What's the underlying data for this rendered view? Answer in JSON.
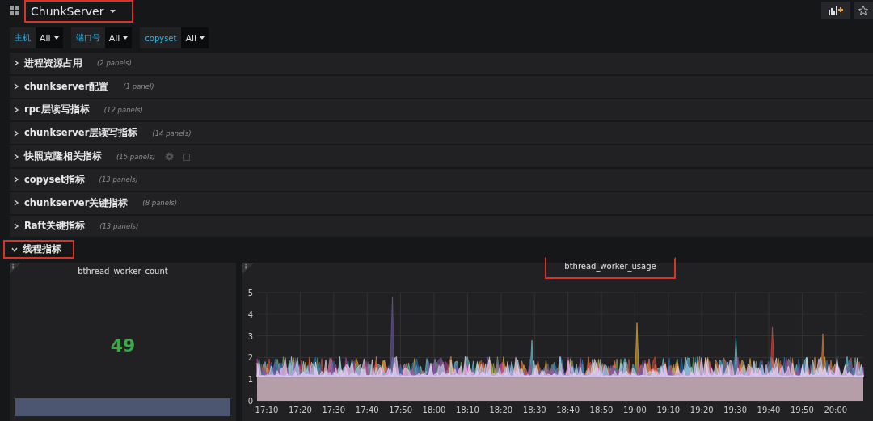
{
  "header": {
    "title": "ChunkServer",
    "highlighted": true
  },
  "variables": [
    {
      "label": "主机",
      "value": "All"
    },
    {
      "label": "端口号",
      "value": "All"
    },
    {
      "label": "copyset",
      "value": "All"
    }
  ],
  "rows": [
    {
      "title": "进程资源占用",
      "count": "(2 panels)",
      "expanded": false,
      "highlighted": false
    },
    {
      "title": "chunkserver配置",
      "count": "(1 panel)",
      "expanded": false,
      "highlighted": false
    },
    {
      "title": "rpc层读写指标",
      "count": "(12 panels)",
      "expanded": false,
      "highlighted": false
    },
    {
      "title": "chunkserver层读写指标",
      "count": "(14 panels)",
      "expanded": false,
      "highlighted": false
    },
    {
      "title": "快照克隆相关指标",
      "count": "(15 panels)",
      "expanded": false,
      "highlighted": false,
      "actions": true
    },
    {
      "title": "copyset指标",
      "count": "(13 panels)",
      "expanded": false,
      "highlighted": false
    },
    {
      "title": "chunkserver关键指标",
      "count": "(8 panels)",
      "expanded": false,
      "highlighted": false
    },
    {
      "title": "Raft关键指标",
      "count": "(13 panels)",
      "expanded": false,
      "highlighted": false
    },
    {
      "title": "线程指标",
      "expanded": true,
      "highlighted": true
    }
  ],
  "stat_panel": {
    "title": "bthread_worker_count",
    "value": "49",
    "color": "#3aa845"
  },
  "graph_panel": {
    "title": "bthread_worker_usage",
    "highlighted": true,
    "y_ticks": [
      "5",
      "4",
      "3",
      "2",
      "1",
      "0"
    ],
    "x_ticks": [
      "17:10",
      "17:20",
      "17:30",
      "17:40",
      "17:50",
      "18:00",
      "18:10",
      "18:20",
      "18:30",
      "18:40",
      "18:50",
      "19:00",
      "19:10",
      "19:20",
      "19:30",
      "19:40",
      "19:50",
      "20:00"
    ]
  }
}
